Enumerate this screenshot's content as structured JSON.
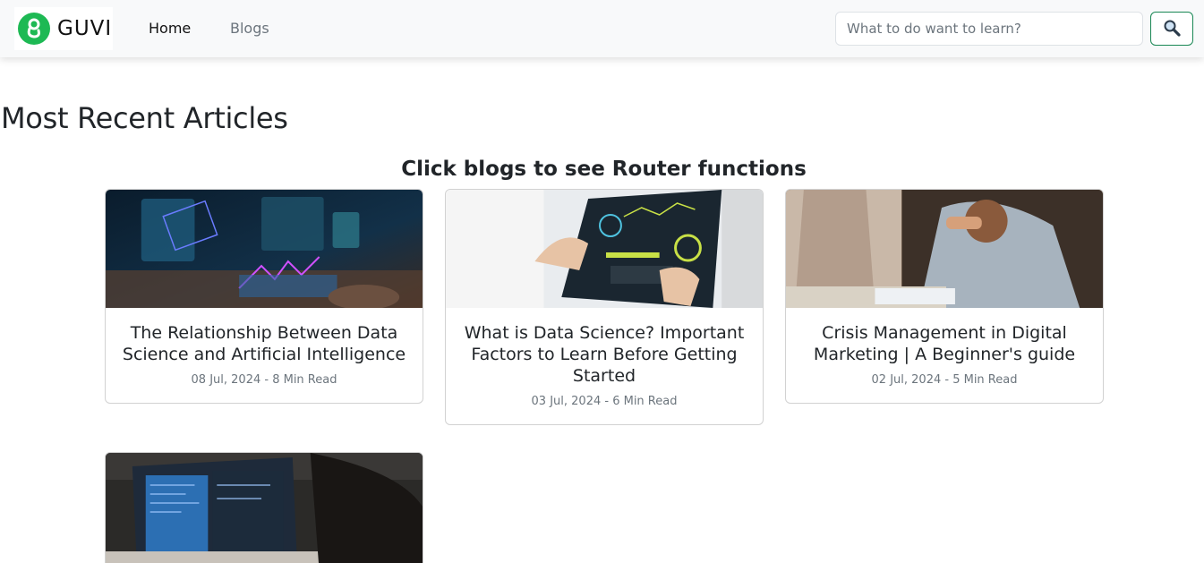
{
  "brand": {
    "name": "GUVI",
    "color": "#1db954"
  },
  "nav": {
    "items": [
      {
        "label": "Home",
        "active": true
      },
      {
        "label": "Blogs",
        "active": false
      }
    ]
  },
  "search": {
    "placeholder": "What to do want to learn?",
    "value": "",
    "button_icon": "search-icon"
  },
  "main": {
    "title": "Most Recent Articles",
    "subtitle": "Click blogs to see Router functions"
  },
  "articles": [
    {
      "title": "The Relationship Between Data Science and Artificial Intelligence",
      "date": "08 Jul, 2024",
      "read_time": "8 Min Read",
      "meta": "08 Jul, 2024 - 8 Min Read"
    },
    {
      "title": "What is Data Science? Important Factors to Learn Before Getting Started",
      "date": "03 Jul, 2024",
      "read_time": "6 Min Read",
      "meta": "03 Jul, 2024 - 6 Min Read"
    },
    {
      "title": "Crisis Management in Digital Marketing | A Beginner's guide",
      "date": "02 Jul, 2024",
      "read_time": "5 Min Read",
      "meta": "02 Jul, 2024 - 5 Min Read"
    },
    {
      "title": "",
      "meta": ""
    }
  ]
}
